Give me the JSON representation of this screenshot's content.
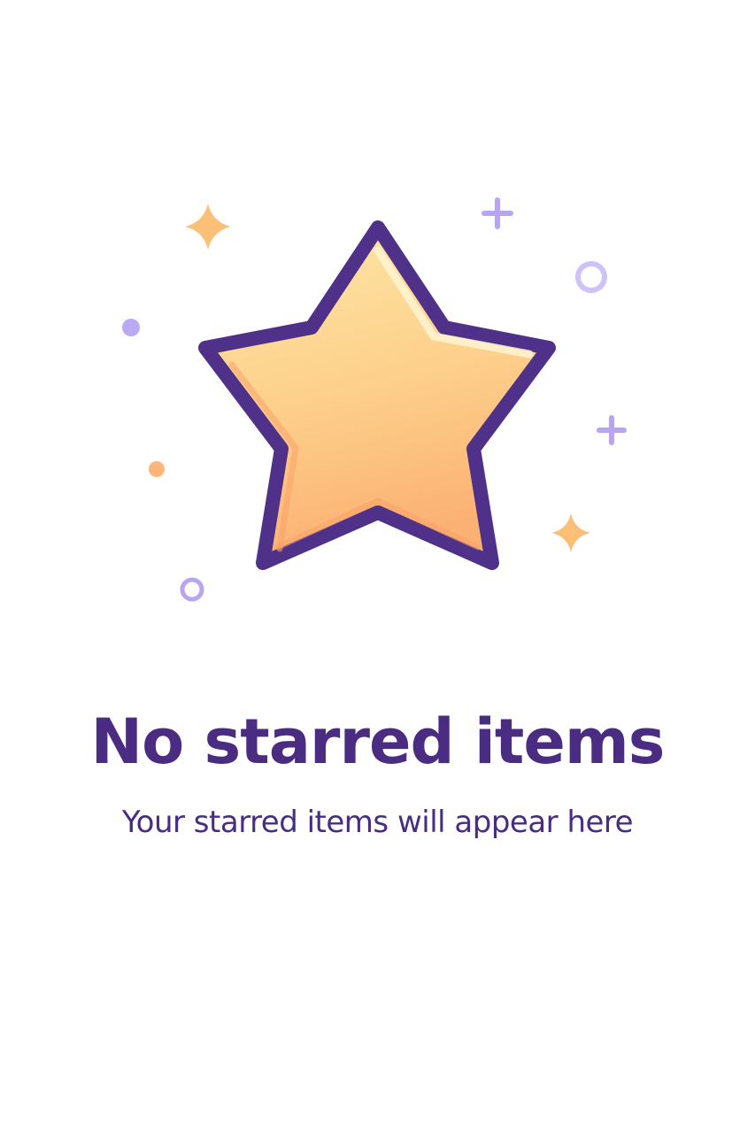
{
  "empty_state": {
    "title": "No starred items",
    "subtitle": "Your starred items will appear here",
    "illustration_icon": "star-icon"
  },
  "colors": {
    "text_primary": "#4a2c82",
    "star_outline": "#4f3189",
    "star_fill_top": "#fde7a6",
    "star_fill_bottom": "#fbb173",
    "sparkle_orange": "#fbbf77",
    "accent_purple": "#b9a4f2",
    "background": "#ffffff"
  }
}
